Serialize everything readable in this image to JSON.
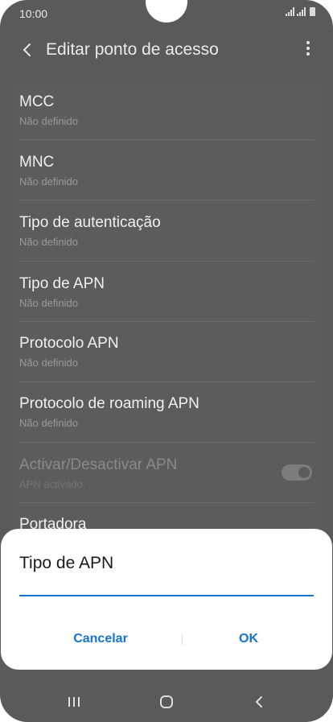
{
  "status_bar": {
    "time": "10:00"
  },
  "app_bar": {
    "title": "Editar ponto de acesso",
    "back_icon": "chevron-left-icon",
    "more_icon": "more-vertical-icon"
  },
  "settings": {
    "items": [
      {
        "title": "MCC",
        "subtitle": "Não definido"
      },
      {
        "title": "MNC",
        "subtitle": "Não definido"
      },
      {
        "title": "Tipo de autenticação",
        "subtitle": "Não definido"
      },
      {
        "title": "Tipo de APN",
        "subtitle": "Não definido"
      },
      {
        "title": "Protocolo APN",
        "subtitle": "Não definido"
      },
      {
        "title": "Protocolo de roaming APN",
        "subtitle": "Não definido"
      },
      {
        "title": "Activar/Desactivar APN",
        "subtitle": "APN activado.",
        "enabled": false,
        "toggle_on": true
      },
      {
        "title": "Portadora"
      }
    ]
  },
  "dialog": {
    "title": "Tipo de APN",
    "input_value": "",
    "cancel_label": "Cancelar",
    "ok_label": "OK",
    "accent_color": "#1674cc"
  },
  "nav_bar": {
    "recent_icon": "recent-apps-icon",
    "home_icon": "home-icon",
    "back_icon": "back-icon"
  }
}
